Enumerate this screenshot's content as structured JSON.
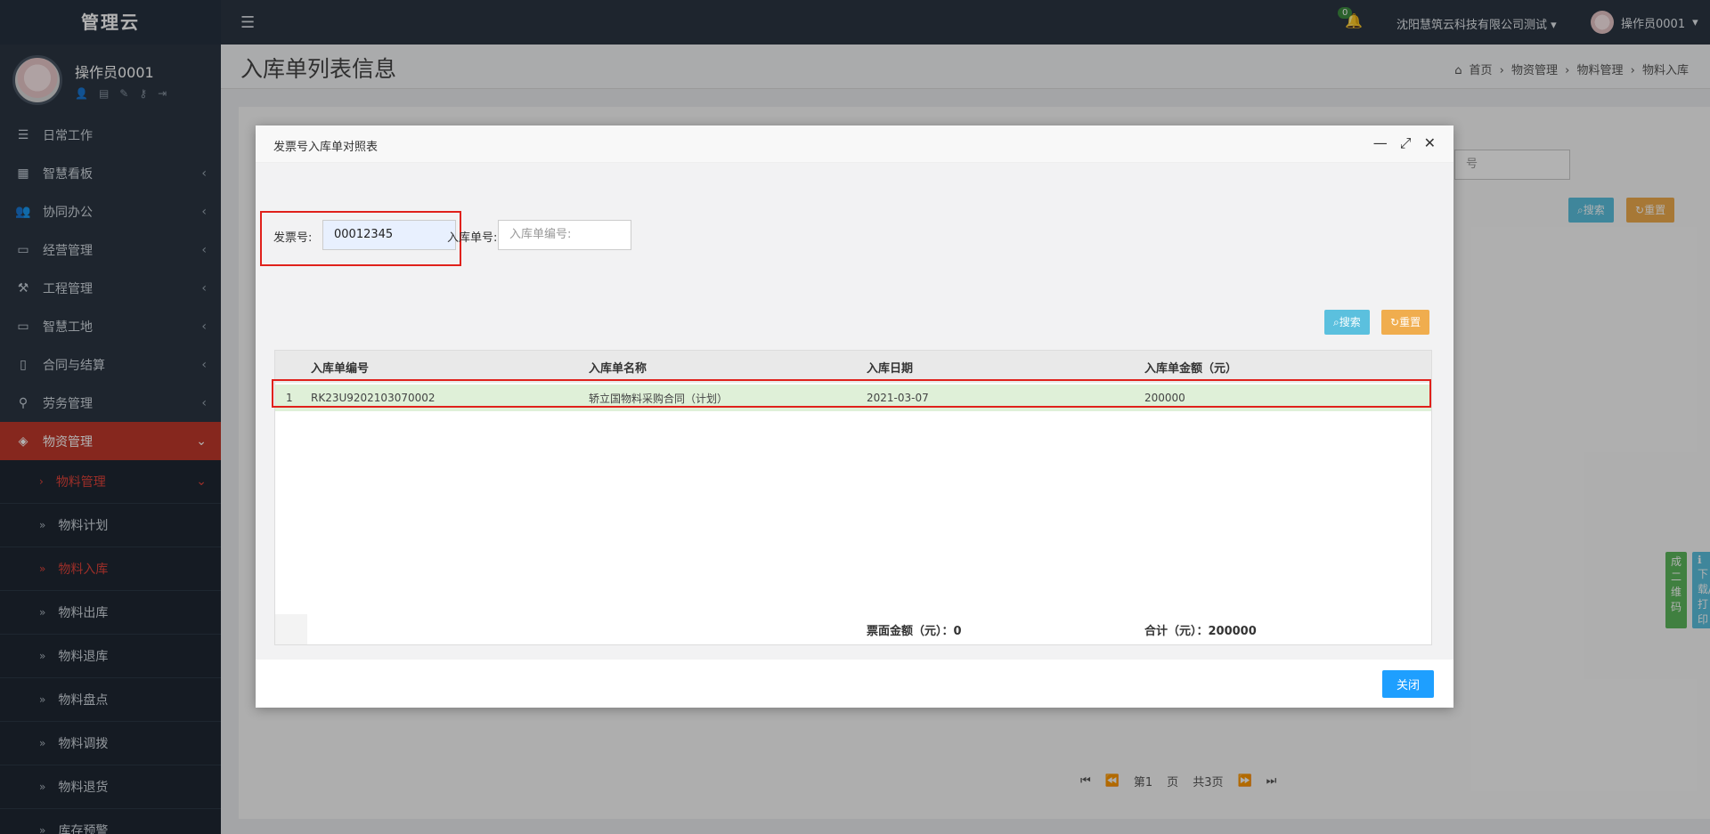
{
  "brand": "管理云",
  "user": {
    "name": "操作员0001"
  },
  "sidebar": {
    "items": [
      {
        "label": "日常工作"
      },
      {
        "label": "智慧看板"
      },
      {
        "label": "协同办公"
      },
      {
        "label": "经营管理"
      },
      {
        "label": "工程管理"
      },
      {
        "label": "智慧工地"
      },
      {
        "label": "合同与结算"
      },
      {
        "label": "劳务管理"
      },
      {
        "label": "物资管理"
      }
    ],
    "submenu": {
      "group": "物料管理",
      "items": [
        "物料计划",
        "物料入库",
        "物料出库",
        "物料退库",
        "物料盘点",
        "物料调拨",
        "物料退货",
        "库存预警"
      ]
    }
  },
  "topbar": {
    "notification_count": "0",
    "company": "沈阳慧筑云科技有限公司测试",
    "user": "操作员0001"
  },
  "page": {
    "title": "入库单列表信息",
    "breadcrumb": [
      "首页",
      "物资管理",
      "物料管理",
      "物料入库"
    ]
  },
  "background": {
    "search_label": "搜索",
    "reset_label": "重置",
    "qr_label": "成二维码",
    "download_label": "下载/打印",
    "input_hint": "号",
    "pager": {
      "first": "第1",
      "page": "页",
      "total": "共3页"
    }
  },
  "modal": {
    "title": "发票号入库单对照表",
    "invoice_label": "发票号:",
    "invoice_value": "00012345",
    "receipt_label": "入库单号:",
    "receipt_placeholder": "入库单编号:",
    "search_label": "搜索",
    "reset_label": "重置",
    "table": {
      "columns": [
        "入库单编号",
        "入库单名称",
        "入库日期",
        "入库单金额（元）"
      ],
      "rows": [
        {
          "index": "1",
          "code": "RK23U9202103070002",
          "name": "轿立国物料采购合同（计划）",
          "date": "2021-03-07",
          "amount": "200000"
        }
      ],
      "footer": {
        "face_amount": "票面金额（元）：0",
        "total": "合计（元）：200000"
      }
    },
    "close_label": "关闭"
  },
  "colors": {
    "sidebar": "#2b3643",
    "active": "#c0392b",
    "row_highlight": "#dff0d8",
    "primary": "#1e9fff",
    "highlight_border": "#e0211b"
  }
}
